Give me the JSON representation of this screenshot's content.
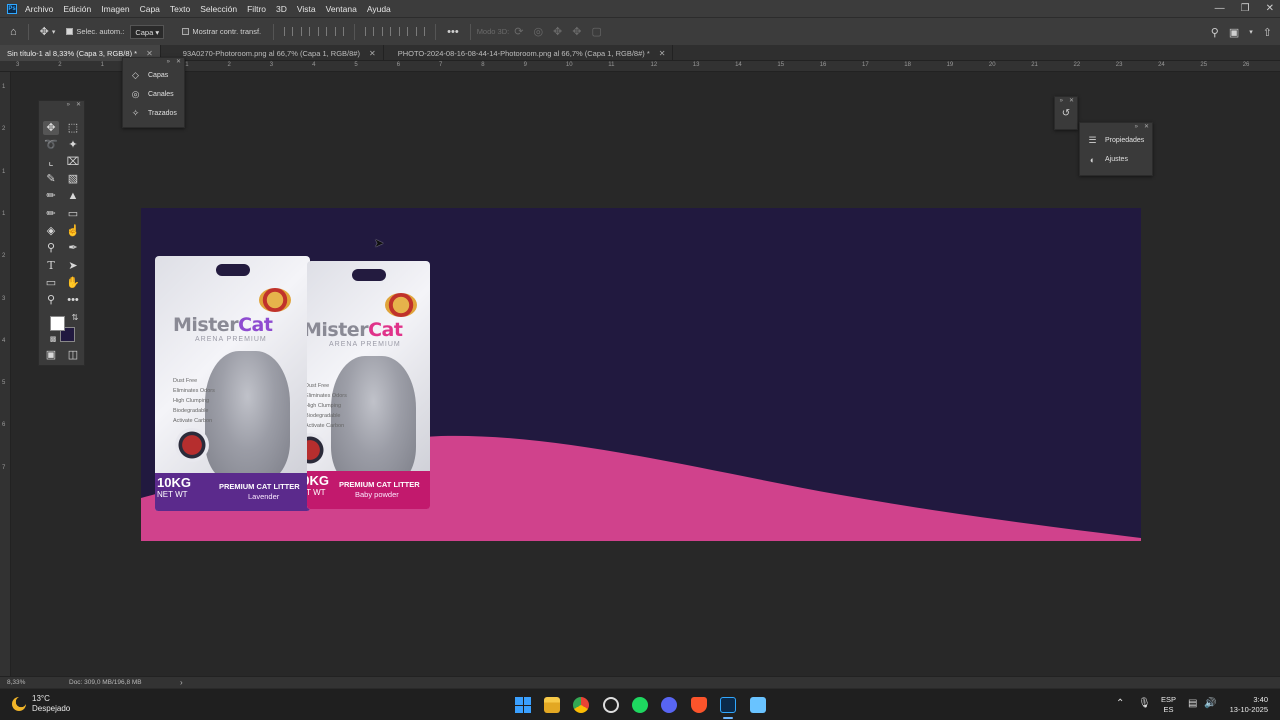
{
  "app": {
    "logo": "Ps"
  },
  "menu": [
    "Archivo",
    "Edición",
    "Imagen",
    "Capa",
    "Texto",
    "Selección",
    "Filtro",
    "3D",
    "Vista",
    "Ventana",
    "Ayuda"
  ],
  "options_bar": {
    "auto_select_label": "Selec. autom.:",
    "auto_select_checked": true,
    "layer_dropdown_value": "Capa",
    "transform_controls_label": "Mostrar contr. transf.",
    "transform_controls_checked": false,
    "mode_3d_label": "Modo 3D:"
  },
  "tabs": [
    {
      "label": "Sin título-1 al 8,33% (Capa 3, RGB/8) *",
      "active": true
    },
    {
      "label": "93A0270-Photoroom.png al 66,7% (Capa 1, RGB/8#)",
      "active": false
    },
    {
      "label": "PHOTO-2024-08-16-08-44-14-Photoroom.png al 66,7% (Capa 1, RGB/8#) *",
      "active": false
    }
  ],
  "ruler_top_labels": [
    "3",
    "2",
    "1",
    "0",
    "1",
    "2",
    "3",
    "4",
    "5",
    "6",
    "7",
    "8",
    "9",
    "10",
    "11",
    "12",
    "13",
    "14",
    "15",
    "16",
    "17",
    "18",
    "19",
    "20",
    "21",
    "22",
    "23",
    "24",
    "25",
    "26"
  ],
  "ruler_left_labels": [
    "1",
    "2",
    "1",
    "1",
    "2",
    "3",
    "4",
    "5",
    "6",
    "7"
  ],
  "layers_panel": {
    "items": [
      "Capas",
      "Canales",
      "Trazados"
    ]
  },
  "properties_panel": {
    "items": [
      "Propiedades",
      "Ajustes"
    ]
  },
  "canvas": {
    "background_color": "#21193f",
    "wave_color": "#d0428c",
    "bags": [
      {
        "brand_left": "Mister",
        "brand_right": "Cat",
        "subtitle": "ARENA PREMIUM",
        "features": "Dust Free\nEliminates Odors\nHigh Clumping\nBiodegradable\nActivate Carbon",
        "weight": "10KG",
        "weight_sub": "NET WT",
        "product": "PREMIUM CAT LITTER",
        "variant": "Lavender",
        "strip_color": "#5b2a8c",
        "accent_color": "#8e4bd0"
      },
      {
        "brand_left": "Mister",
        "brand_right": "Cat",
        "subtitle": "ARENA PREMIUM",
        "features": "Dust Free\nEliminates Odors\nHigh Clumping\nBiodegradable\nActivate Carbon",
        "weight": "10KG",
        "weight_sub": "NET WT",
        "product": "PREMIUM CAT LITTER",
        "variant": "Baby powder",
        "strip_color": "#c2196d",
        "accent_color": "#e0338a"
      }
    ]
  },
  "status_bar": {
    "zoom": "8,33%",
    "doc_info": "Doc: 309,0 MB/196,8 MB"
  },
  "taskbar": {
    "weather_temp": "13°C",
    "weather_desc": "Despejado",
    "lang_top": "ESP",
    "lang_bottom": "ES",
    "time": "3:40",
    "date": "13-10-2025"
  },
  "colors": {
    "foreground": "#ffffff",
    "background": "#21193f"
  }
}
